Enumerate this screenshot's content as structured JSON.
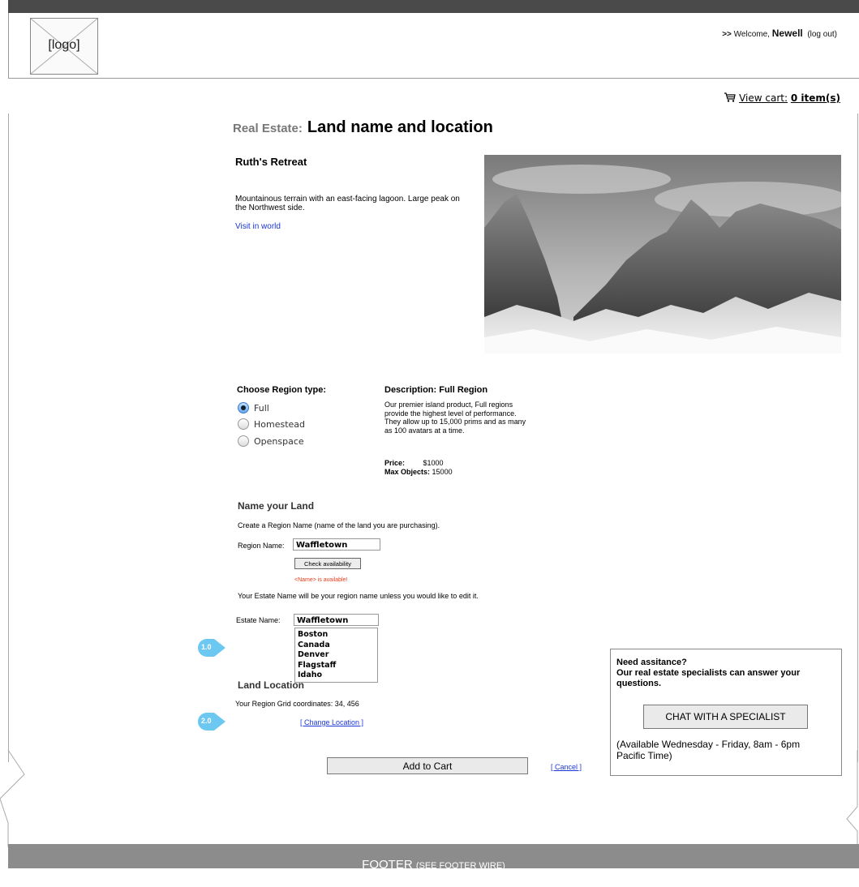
{
  "header": {
    "logo_label": "[logo]",
    "welcome_prefix": ">>",
    "welcome_text": "Welcome,",
    "username": "Newell",
    "logout_label": "(log out)"
  },
  "cart": {
    "label": "View cart:",
    "count": "0 item(s)"
  },
  "page": {
    "title_prefix": "Real Estate:",
    "title": "Land name and location"
  },
  "land": {
    "name": "Ruth's Retreat",
    "description": "Mountainous terrain with an east-facing lagoon. Large peak on the Northwest side.",
    "visit_link": "Visit in world"
  },
  "region_type": {
    "heading": "Choose Region type:",
    "options": [
      {
        "label": "Full",
        "selected": true
      },
      {
        "label": "Homestead",
        "selected": false
      },
      {
        "label": "Openspace",
        "selected": false
      }
    ]
  },
  "description": {
    "heading": "Description: Full Region",
    "body": "Our premier island product, Full regions provide the highest level of performance. They allow up to 15,000 prims and as many as 100 avatars at a time.",
    "price_label": "Price:",
    "price_value": "$1000",
    "max_objects_label": "Max Objects:",
    "max_objects_value": "15000"
  },
  "name_land": {
    "heading": "Name your Land",
    "instruction": "Create a Region Name (name of the land you are purchasing).",
    "region_label": "Region Name:",
    "region_value": "Waffletown",
    "check_button": "Check availability",
    "availability_msg": "<Name> is available!",
    "estate_note": "Your Estate Name will be your region name unless you would like to edit it.",
    "estate_label": "Estate Name:",
    "estate_value": "Waffletown",
    "estate_options": [
      "Boston",
      "Canada",
      "Denver",
      "Flagstaff",
      "Idaho"
    ]
  },
  "callouts": {
    "first": "1.0",
    "second": "2.0"
  },
  "location": {
    "heading": "Land Location",
    "coords_label": "Your Region Grid coordinates:",
    "coords_value": "34, 456",
    "change_link": "[ Change Location ]"
  },
  "actions": {
    "add_to_cart": "Add to Cart",
    "cancel": "[ Cancel ]"
  },
  "help": {
    "heading": "Need assitance?",
    "subheading": "Our real estate specialists can answer your questions.",
    "chat_button": "CHAT WITH A SPECIALIST",
    "hours": "(Available Wednesday - Friday, 8am - 6pm Pacific Time)"
  },
  "footer": {
    "label": "FOOTER",
    "note": "(SEE FOOTER WIRE)"
  },
  "colors": {
    "link": "#1a35d6",
    "alert": "#e63a18",
    "callout": "#6cc8f0",
    "footer_bg": "#8c8c8c"
  }
}
